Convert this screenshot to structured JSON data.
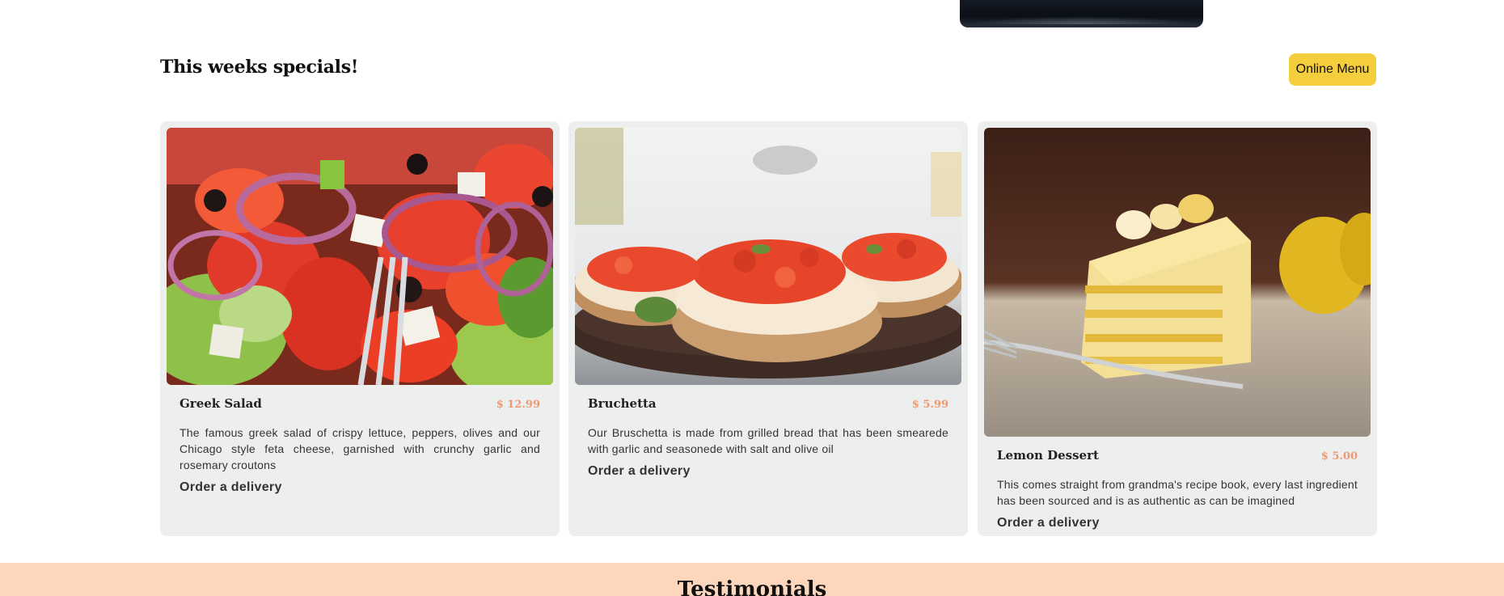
{
  "specials": {
    "title": "This weeks specials!",
    "menu_button_label": "Online Menu"
  },
  "dishes": [
    {
      "name": "Greek Salad",
      "price": "$ 12.99",
      "description": "The famous greek salad of crispy lettuce, peppers, olives and our Chicago style feta cheese, garnished with crunchy garlic and rosemary croutons",
      "order_label": "Order a delivery",
      "image_icon": "greek-salad-photo"
    },
    {
      "name": "Bruchetta",
      "price": "$ 5.99",
      "description": "Our Bruschetta is made from grilled bread that has been smearede with garlic and seasonede with salt and olive oil",
      "order_label": "Order a delivery",
      "image_icon": "bruschetta-photo"
    },
    {
      "name": "Lemon Dessert",
      "price": "$ 5.00",
      "description": "This comes straight from grandma's recipe book, every last ingredient has been sourced and is as authentic as can be imagined",
      "order_label": "Order a delivery",
      "image_icon": "lemon-dessert-photo"
    }
  ],
  "testimonials": {
    "title": "Testimonials"
  },
  "colors": {
    "accent_yellow": "#f4ce3d",
    "price_salmon": "#ee9972",
    "card_background": "#edefee",
    "testimonials_background": "#fdd6bc"
  }
}
